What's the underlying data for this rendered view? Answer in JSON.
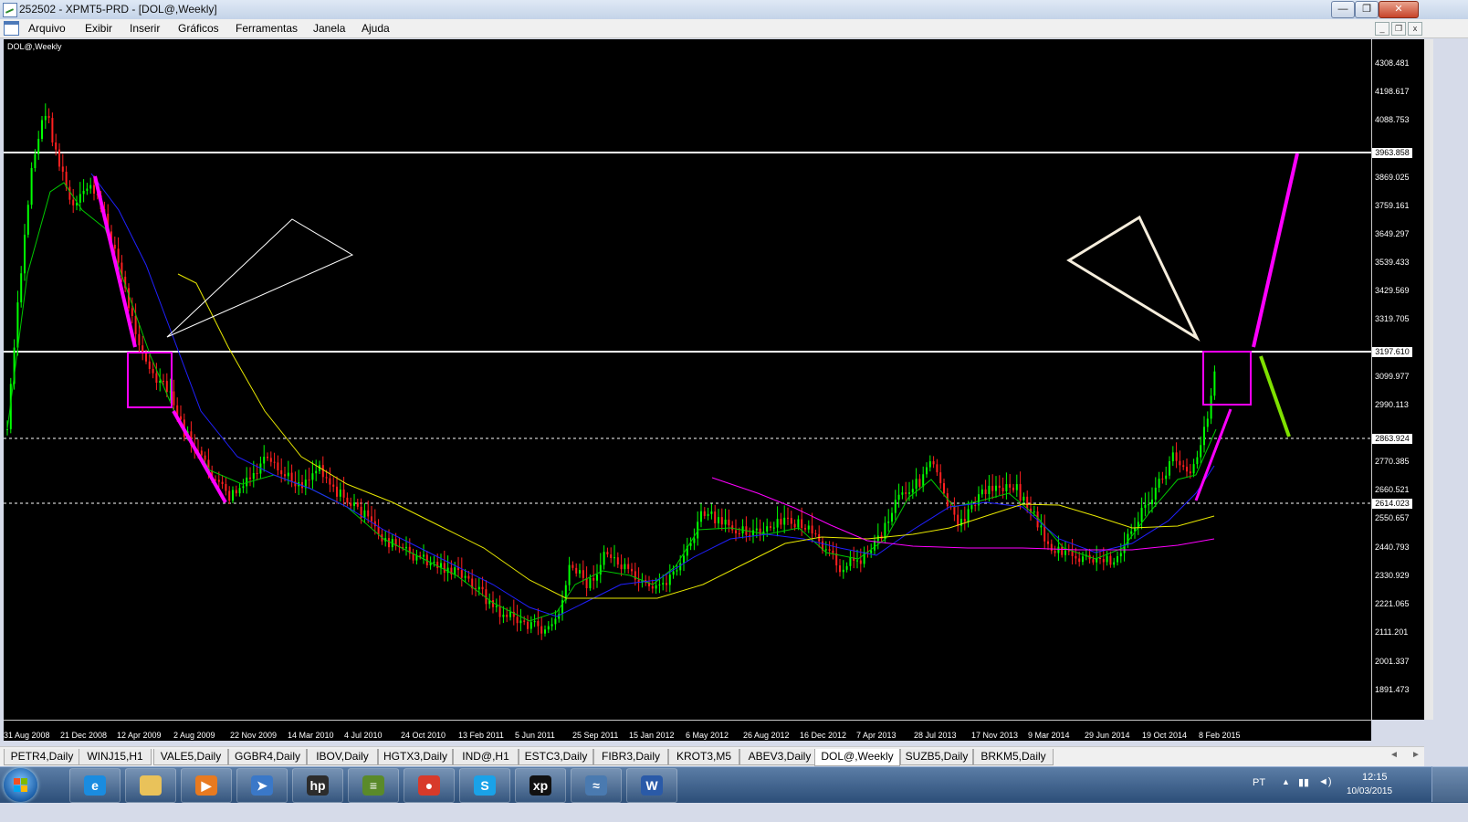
{
  "window": {
    "title": "252502 - XPMT5-PRD - [DOL@,Weekly]",
    "minimize": "—",
    "restore": "❐",
    "close": "✕"
  },
  "menu": {
    "items": [
      "Arquivo",
      "Exibir",
      "Inserir",
      "Gráficos",
      "Ferramentas",
      "Janela",
      "Ajuda"
    ],
    "mdi_minimize": "_",
    "mdi_restore": "❐",
    "mdi_close": "x"
  },
  "chart": {
    "label": "DOL@,Weekly",
    "price_ticks": [
      "4308.481",
      "4198.617",
      "4088.753",
      "3869.025",
      "3759.161",
      "3649.297",
      "3539.433",
      "3429.569",
      "3319.705",
      "3099.977",
      "2990.113",
      "2770.385",
      "2660.521",
      "2550.657",
      "2440.793",
      "2330.929",
      "2221.065",
      "2111.201",
      "2001.337",
      "1891.473"
    ],
    "highlight_levels": [
      "3963.858",
      "3197.610",
      "2863.924",
      "2614.023"
    ],
    "date_ticks": [
      "31 Aug 2008",
      "21 Dec 2008",
      "12 Apr 2009",
      "2 Aug 2009",
      "22 Nov 2009",
      "14 Mar 2010",
      "4 Jul 2010",
      "24 Oct 2010",
      "13 Feb 2011",
      "5 Jun 2011",
      "25 Sep 2011",
      "15 Jan 2012",
      "6 May 2012",
      "26 Aug 2012",
      "16 Dec 2012",
      "7 Apr 2013",
      "28 Jul 2013",
      "17 Nov 2013",
      "9 Mar 2014",
      "29 Jun 2014",
      "19 Oct 2014",
      "8 Feb 2015"
    ],
    "colors": {
      "background": "#000000",
      "bull": "#00ff00",
      "bear": "#ff2020",
      "ma_fast": "#00c800",
      "ma_mid": "#2020ff",
      "ma_slow": "#e8e800",
      "ma_long": "#ff00ff",
      "annotation_magenta": "#ff00ff",
      "annotation_green": "#7fe000",
      "hline": "#ffffff"
    }
  },
  "tabs": {
    "items": [
      "PETR4,Daily",
      "WINJ15,H1",
      "VALE5,Daily",
      "GGBR4,Daily",
      "IBOV,Daily",
      "HGTX3,Daily",
      "IND@,H1",
      "ESTC3,Daily",
      "FIBR3,Daily",
      "KROT3,M5",
      "ABEV3,Daily",
      "DOL@,Weekly",
      "SUZB5,Daily",
      "BRKM5,Daily"
    ],
    "active": "DOL@,Weekly",
    "scroll_left": "◄",
    "scroll_right": "►"
  },
  "taskbar": {
    "apps": [
      {
        "name": "internet-explorer",
        "glyph": "e",
        "color": "#1a8ce0"
      },
      {
        "name": "file-explorer",
        "glyph": "",
        "color": "#e9c25a"
      },
      {
        "name": "media-player",
        "glyph": "▶",
        "color": "#e87a20"
      },
      {
        "name": "arrow-app",
        "glyph": "➤",
        "color": "#3a78c8"
      },
      {
        "name": "hp-app",
        "glyph": "hp",
        "color": "#2c2c2c"
      },
      {
        "name": "metatrader-app",
        "glyph": "≡",
        "color": "#5a8a2a"
      },
      {
        "name": "chrome",
        "glyph": "●",
        "color": "#d83a2a"
      },
      {
        "name": "skype",
        "glyph": "S",
        "color": "#1aa2e8"
      },
      {
        "name": "xp-app",
        "glyph": "xp",
        "color": "#111111"
      },
      {
        "name": "trading-terminal",
        "glyph": "≈",
        "color": "#4a7ab0"
      },
      {
        "name": "word",
        "glyph": "W",
        "color": "#2a5aa8"
      }
    ],
    "language": "PT",
    "time": "12:15",
    "date": "10/03/2015"
  }
}
